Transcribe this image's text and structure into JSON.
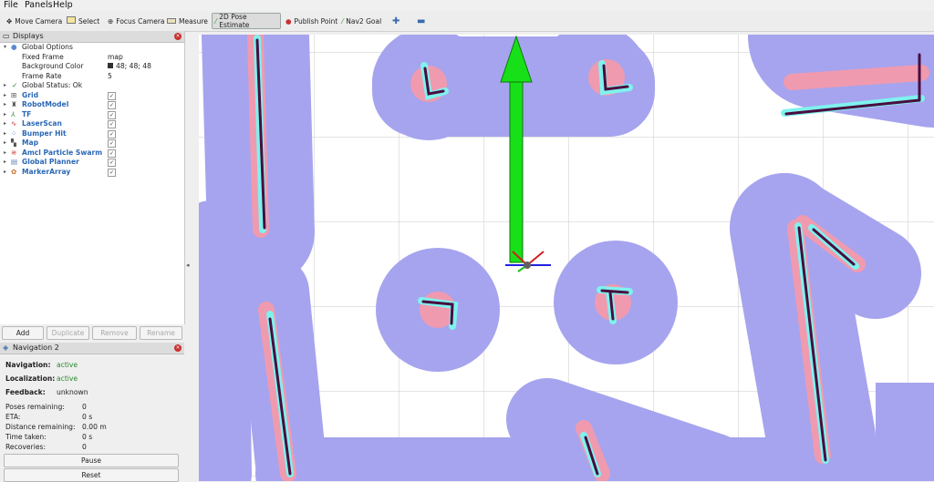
{
  "menu": {
    "file": "File",
    "panels": "Panels",
    "help": "Help"
  },
  "toolbar": {
    "move_camera": "Move Camera",
    "select": "Select",
    "focus_camera": "Focus Camera",
    "measure": "Measure",
    "pose_estimate": "2D Pose Estimate",
    "publish_point": "Publish Point",
    "nav2_goal": "Nav2 Goal",
    "add_icon": "plus-icon",
    "remove_icon": "minus-icon"
  },
  "displays": {
    "title": "Displays",
    "global_options": "Global Options",
    "fixed_frame_label": "Fixed Frame",
    "fixed_frame_value": "map",
    "background_color_label": "Background Color",
    "background_color_value": "48; 48; 48",
    "frame_rate_label": "Frame Rate",
    "frame_rate_value": "5",
    "global_status": "Global Status: Ok",
    "items": [
      {
        "label": "Grid",
        "checked": true
      },
      {
        "label": "RobotModel",
        "checked": true
      },
      {
        "label": "TF",
        "checked": true
      },
      {
        "label": "LaserScan",
        "checked": true
      },
      {
        "label": "Bumper Hit",
        "checked": true
      },
      {
        "label": "Map",
        "checked": true
      },
      {
        "label": "Amcl Particle Swarm",
        "checked": true
      },
      {
        "label": "Global Planner",
        "checked": true
      },
      {
        "label": "MarkerArray",
        "checked": true
      }
    ],
    "buttons": {
      "add": "Add",
      "duplicate": "Duplicate",
      "remove": "Remove",
      "rename": "Rename"
    }
  },
  "navigation": {
    "title": "Navigation 2",
    "navigation_label": "Navigation:",
    "navigation_value": "active",
    "localization_label": "Localization:",
    "localization_value": "active",
    "feedback_label": "Feedback:",
    "feedback_value": "unknown",
    "poses_label": "Poses remaining:",
    "poses_value": "0",
    "eta_label": "ETA:",
    "eta_value": "0 s",
    "distance_label": "Distance remaining:",
    "distance_value": "0.00 m",
    "time_label": "Time taken:",
    "time_value": "0 s",
    "recoveries_label": "Recoveries:",
    "recoveries_value": "0",
    "pause": "Pause",
    "reset": "Reset"
  },
  "colors": {
    "costmap_blue": "#a6a4ee",
    "inflation_pink": "#f09ab0",
    "obstacle_cyan": "#7ff2ee",
    "wall_dark": "#4a0c3e",
    "pose_arrow": "#18e018"
  }
}
